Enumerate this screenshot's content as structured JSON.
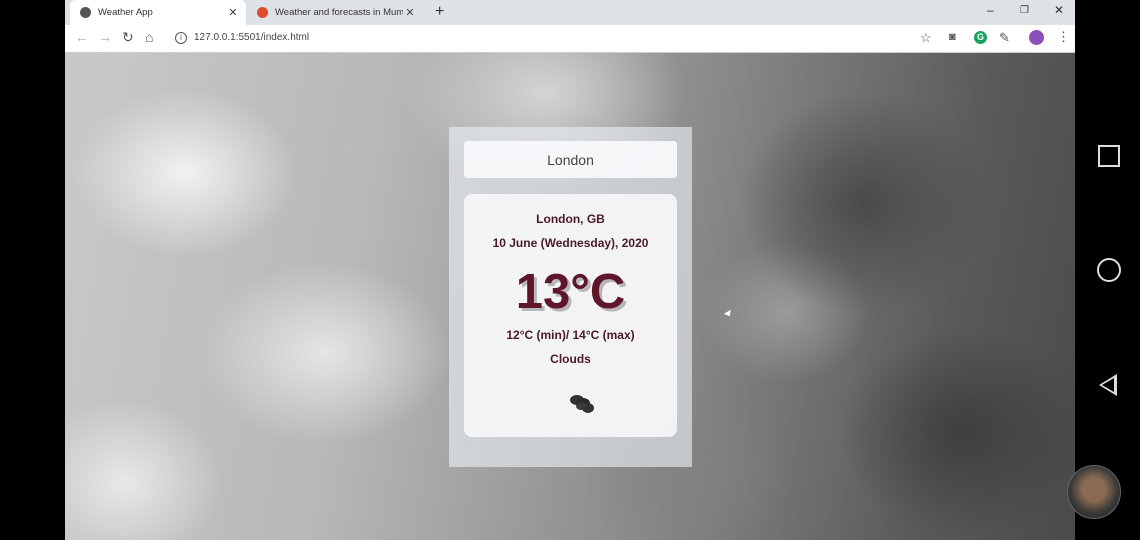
{
  "browser": {
    "tabs": [
      {
        "title": "Weather App",
        "favicon_color": "#555555"
      },
      {
        "title": "Weather and forecasts in Mumba",
        "favicon_color": "#e0492f"
      }
    ],
    "new_tab_symbol": "+",
    "url": "127.0.0.1:5501/index.html",
    "window_controls": {
      "minimize": "–",
      "restore": "❐",
      "close": "✕"
    }
  },
  "weather": {
    "search_value": "London",
    "city": "London, GB",
    "date": "10 June (Wednesday), 2020",
    "temperature": "13°C",
    "min_max": "12°C (min)/ 14°C (max)",
    "condition": "Clouds",
    "icon": "clouds-icon"
  },
  "colors": {
    "temperature": "#5e1628",
    "text": "#4a1a24"
  }
}
